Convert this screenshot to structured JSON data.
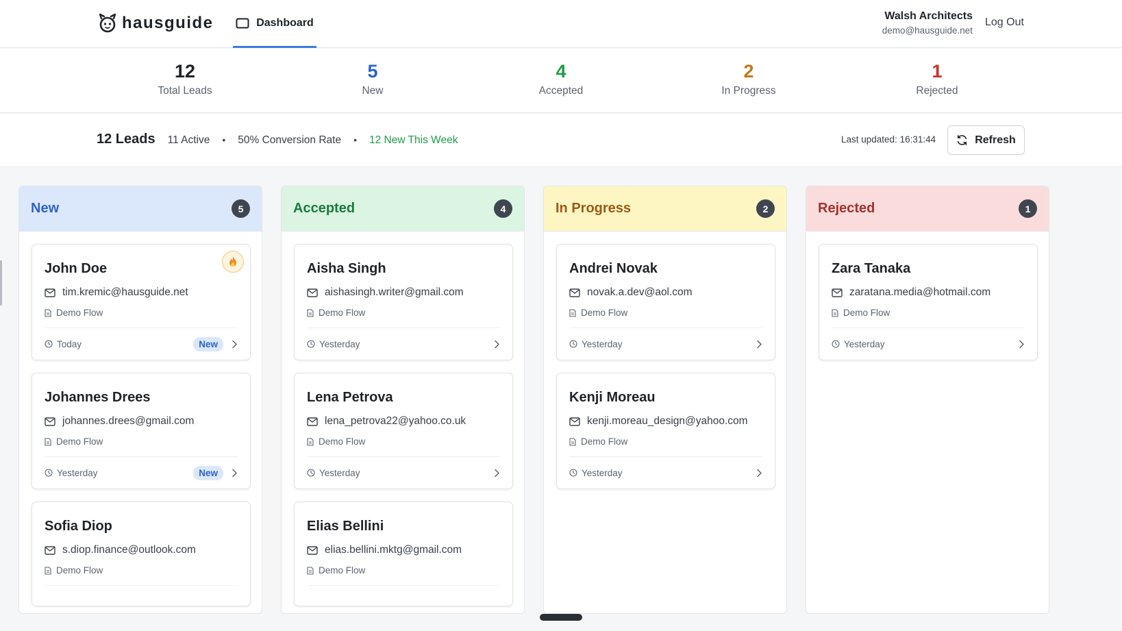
{
  "app": {
    "logo_text": "hausguide",
    "nav_tab": "Dashboard",
    "account_name": "Walsh Architects",
    "account_email": "demo@hausguide.net",
    "logout_label": "Log Out"
  },
  "stats": [
    {
      "value": "12",
      "label": "Total Leads",
      "color": "#1f2328"
    },
    {
      "value": "5",
      "label": "New",
      "color": "#2d63c8"
    },
    {
      "value": "4",
      "label": "Accepted",
      "color": "#1f9d4a"
    },
    {
      "value": "2",
      "label": "In Progress",
      "color": "#c27a1b"
    },
    {
      "value": "1",
      "label": "Rejected",
      "color": "#c8322d"
    }
  ],
  "summary": {
    "leads": "12 Leads",
    "active": "11 Active",
    "dot": "•",
    "conversion": "50% Conversion Rate",
    "new_week": "12 New This Week",
    "last_updated": "Last updated: 16:31:44",
    "refresh_label": "Refresh"
  },
  "columns": [
    {
      "title": "New",
      "count": "5",
      "title_color": "#2d63c8",
      "head_bg": "#dbe8fb",
      "cards": [
        {
          "name": "John Doe",
          "email": "tim.kremic@hausguide.net",
          "flow": "Demo Flow",
          "time": "Today",
          "badge": "New",
          "hot": true
        },
        {
          "name": "Johannes Drees",
          "email": "johannes.drees@gmail.com",
          "flow": "Demo Flow",
          "time": "Yesterday",
          "badge": "New",
          "hot": false
        },
        {
          "name": "Sofia Diop",
          "email": "s.diop.finance@outlook.com",
          "flow": "Demo Flow",
          "time": "",
          "badge": "",
          "hot": false
        }
      ]
    },
    {
      "title": "Accepted",
      "count": "4",
      "title_color": "#1a7a3d",
      "head_bg": "#dcf5e3",
      "cards": [
        {
          "name": "Aisha Singh",
          "email": "aishasingh.writer@gmail.com",
          "flow": "Demo Flow",
          "time": "Yesterday",
          "badge": "",
          "hot": false
        },
        {
          "name": "Lena Petrova",
          "email": "lena_petrova22@yahoo.co.uk",
          "flow": "Demo Flow",
          "time": "Yesterday",
          "badge": "",
          "hot": false
        },
        {
          "name": "Elias Bellini",
          "email": "elias.bellini.mktg@gmail.com",
          "flow": "Demo Flow",
          "time": "",
          "badge": "",
          "hot": false
        }
      ]
    },
    {
      "title": "In Progress",
      "count": "2",
      "title_color": "#9a5a13",
      "head_bg": "#fdf6c3",
      "cards": [
        {
          "name": "Andrei Novak",
          "email": "novak.a.dev@aol.com",
          "flow": "Demo Flow",
          "time": "Yesterday",
          "badge": "",
          "hot": false
        },
        {
          "name": "Kenji Moreau",
          "email": "kenji.moreau_design@yahoo.com",
          "flow": "Demo Flow",
          "time": "Yesterday",
          "badge": "",
          "hot": false
        }
      ]
    },
    {
      "title": "Rejected",
      "count": "1",
      "title_color": "#a3322d",
      "head_bg": "#fbdcdc",
      "cards": [
        {
          "name": "Zara Tanaka",
          "email": "zaratana.media@hotmail.com",
          "flow": "Demo Flow",
          "time": "Yesterday",
          "badge": "",
          "hot": false
        }
      ]
    }
  ]
}
